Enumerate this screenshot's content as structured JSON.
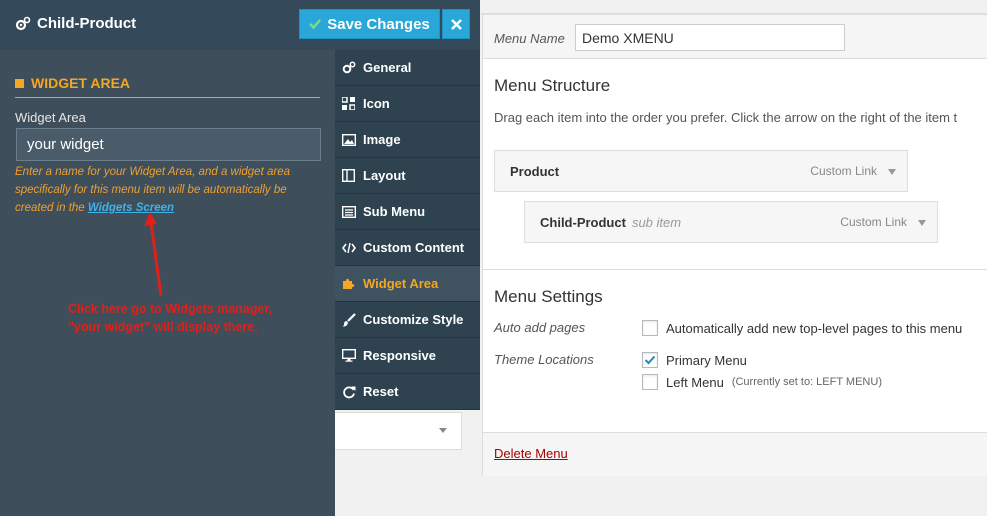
{
  "panel": {
    "title": "Child-Product",
    "save_label": "Save Changes",
    "section_title": "WIDGET AREA",
    "field_label": "Widget Area",
    "field_value": "your widget",
    "help_text": "Enter a name for your Widget Area, and a widget area specifically for this menu item will be automatically be created in the ",
    "help_link": "Widgets Screen",
    "annotation_line1": "Click here go to Widgets manager,",
    "annotation_line2": "\"your widget\" will display there."
  },
  "tabs": [
    {
      "label": "General",
      "icon": "gears-icon"
    },
    {
      "label": "Icon",
      "icon": "grid-icon"
    },
    {
      "label": "Image",
      "icon": "image-icon"
    },
    {
      "label": "Layout",
      "icon": "columns-icon"
    },
    {
      "label": "Sub Menu",
      "icon": "list-icon"
    },
    {
      "label": "Custom Content",
      "icon": "code-icon"
    },
    {
      "label": "Widget Area",
      "icon": "puzzle-icon",
      "active": true
    },
    {
      "label": "Customize Style",
      "icon": "brush-icon"
    },
    {
      "label": "Responsive",
      "icon": "desktop-icon"
    },
    {
      "label": "Reset",
      "icon": "refresh-icon"
    }
  ],
  "menu": {
    "name_label": "Menu Name",
    "name_value": "Demo XMENU",
    "structure_title": "Menu Structure",
    "structure_desc": "Drag each item into the order you prefer. Click the arrow on the right of the item t",
    "items": [
      {
        "title": "Product",
        "sub": "",
        "type": "Custom Link"
      },
      {
        "title": "Child-Product",
        "sub": "sub item",
        "type": "Custom Link"
      }
    ],
    "settings_title": "Menu Settings",
    "auto_add_label": "Auto add pages",
    "auto_add_text": "Automatically add new top-level pages to this menu",
    "theme_label": "Theme Locations",
    "primary_menu": "Primary Menu",
    "left_menu": "Left Menu",
    "left_menu_note": "(Currently set to: LEFT MENU)",
    "delete_label": "Delete Menu"
  },
  "colors": {
    "panel_bg": "#3e4e5a",
    "accent_orange": "#f5a623",
    "save_blue": "#29a7d8",
    "annotation_red": "#e0201a"
  }
}
